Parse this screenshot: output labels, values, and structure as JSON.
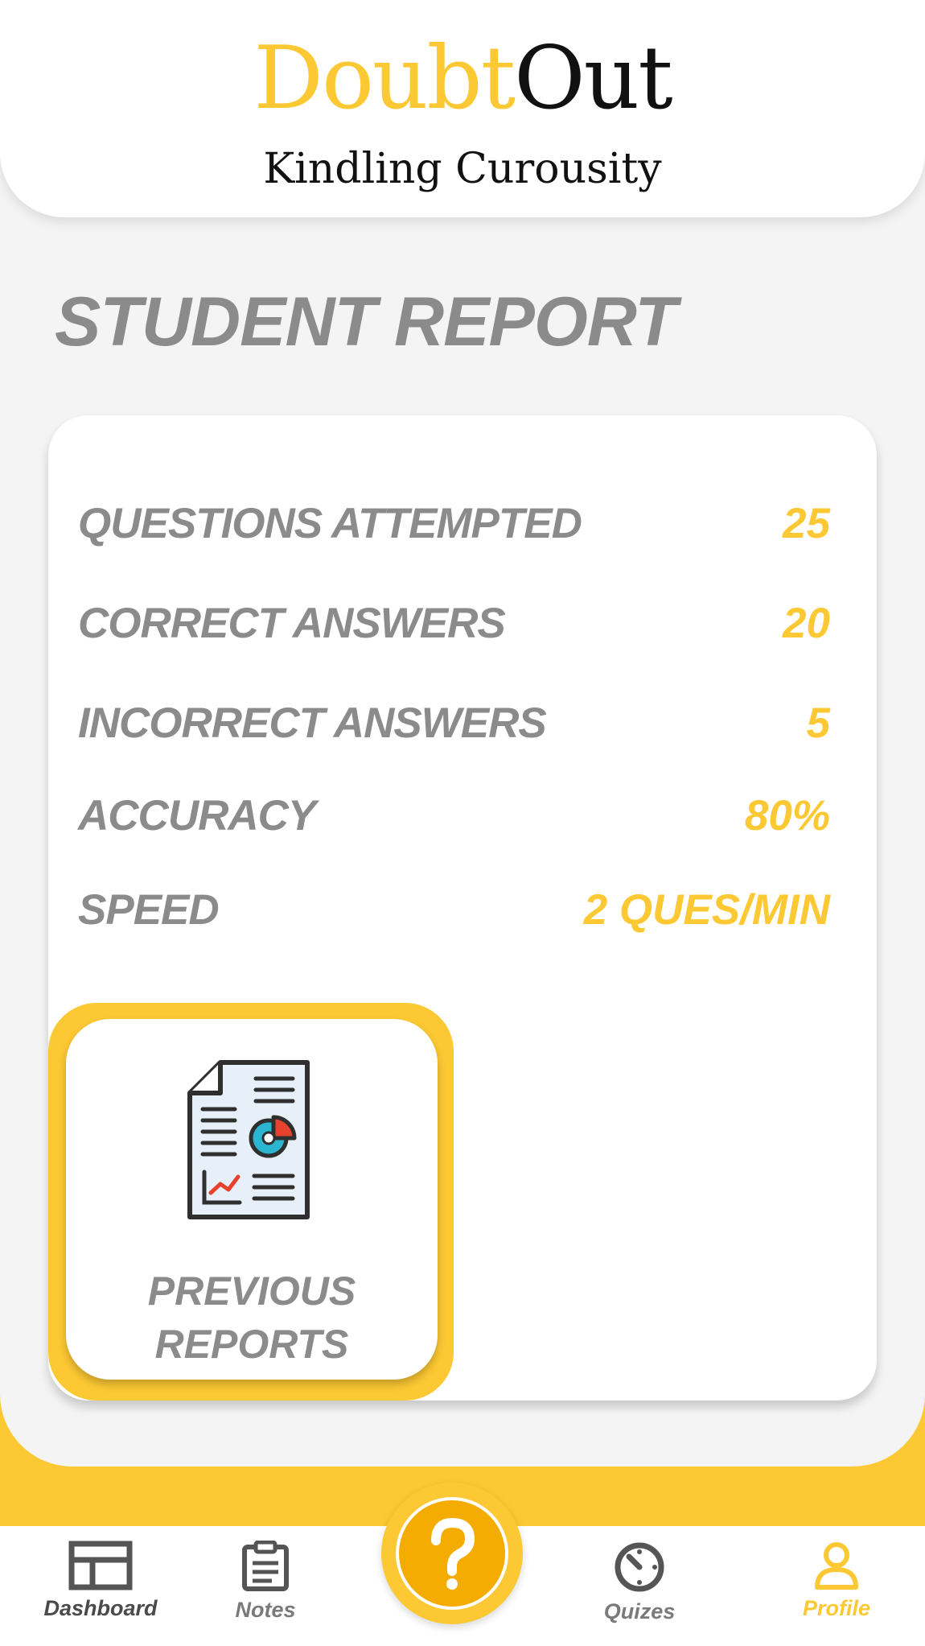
{
  "header": {
    "logo_part1": "Doubt",
    "logo_part2": "Out",
    "tagline": "Kindling Curousity"
  },
  "page_title": "STUDENT REPORT",
  "stats": [
    {
      "label": "QUESTIONS ATTEMPTED",
      "value": "25"
    },
    {
      "label": "CORRECT ANSWERS",
      "value": "20"
    },
    {
      "label": "INCORRECT ANSWERS",
      "value": "5"
    },
    {
      "label": "ACCURACY",
      "value": "80%"
    },
    {
      "label": "SPEED",
      "value": "2 QUES/MIN"
    }
  ],
  "previous_reports": {
    "line1": "PREVIOUS",
    "line2": "REPORTS",
    "icon": "report-document-icon"
  },
  "nav": {
    "dashboard": "Dashboard",
    "notes": "Notes",
    "quizes": "Quizes",
    "profile": "Profile",
    "help_icon": "question-icon"
  },
  "colors": {
    "accent": "#fcc833",
    "accent_dark": "#f5ac00",
    "muted_text": "#8b8b8b",
    "nav_icon": "#555555"
  }
}
